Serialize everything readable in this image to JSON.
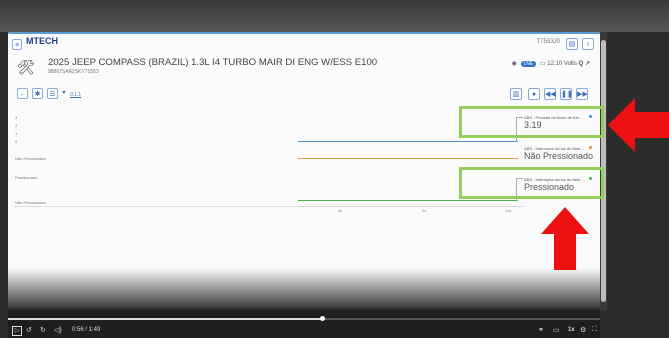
{
  "header": {
    "logo_text": "MTECH",
    "logo_sub": "m",
    "serial": "T7583J0",
    "car_title": "2025 JEEP COMPASS (BRAZIL) 1.3L I4 TURBO MAIR DI ENG W/ESS E100",
    "vin": "98867SAA2SKY71553",
    "voltage": "12.10 Volts",
    "badge": "LNE"
  },
  "toolbar": {
    "version": "0.1.1"
  },
  "rows": [
    {
      "labels": [
        "3",
        "2",
        "1",
        "0"
      ],
      "name": "ABS - Pressão do fluido de frei...",
      "value": "3.19",
      "color": "#4a90c2"
    },
    {
      "labels": [
        "Não Pressionado"
      ],
      "name": "ABS - Interruptor da luz do freio...",
      "value": "Não Pressionado",
      "color": "#d39a3a"
    },
    {
      "labels": [
        "Pressionado",
        "Não Pressionado"
      ],
      "name": "ABS - Interruptor da luz do freio...",
      "value": "Pressionado",
      "color": "#4caf50"
    }
  ],
  "time_ticks": [
    "0s",
    "5s",
    "10s"
  ],
  "player": {
    "time": "0:56 / 1:49",
    "progress": 0.53,
    "speed": "1x"
  },
  "colors": {
    "accent": "#3d6fb6",
    "annotation_green": "#93cf5a",
    "arrow_red": "#ee1111"
  },
  "icons": [
    "menu-icon",
    "back-icon",
    "settings-icon",
    "list-icon",
    "signal-icon",
    "wifi-icon",
    "search-icon",
    "export-icon",
    "record-icon",
    "rewind-icon",
    "pause-icon",
    "forward-icon",
    "play-icon",
    "volume-icon",
    "subtitles-icon",
    "gear-icon",
    "fullscreen-icon"
  ]
}
